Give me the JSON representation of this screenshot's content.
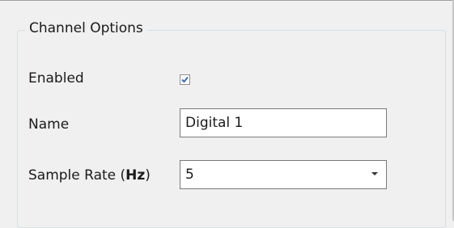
{
  "group": {
    "title": "Channel Options"
  },
  "fields": {
    "enabled": {
      "label": "Enabled",
      "checked": true
    },
    "name": {
      "label": "Name",
      "value": "Digital 1"
    },
    "sample_rate": {
      "label_prefix": "Sample Rate (",
      "label_unit": "Hz",
      "label_suffix": ")",
      "value": "5"
    }
  },
  "colors": {
    "checkbox_check": "#3b6fb6",
    "group_border": "#d5dfe5"
  },
  "icons": {
    "checkbox": "checkmark-icon",
    "dropdown": "chevron-down-icon"
  }
}
